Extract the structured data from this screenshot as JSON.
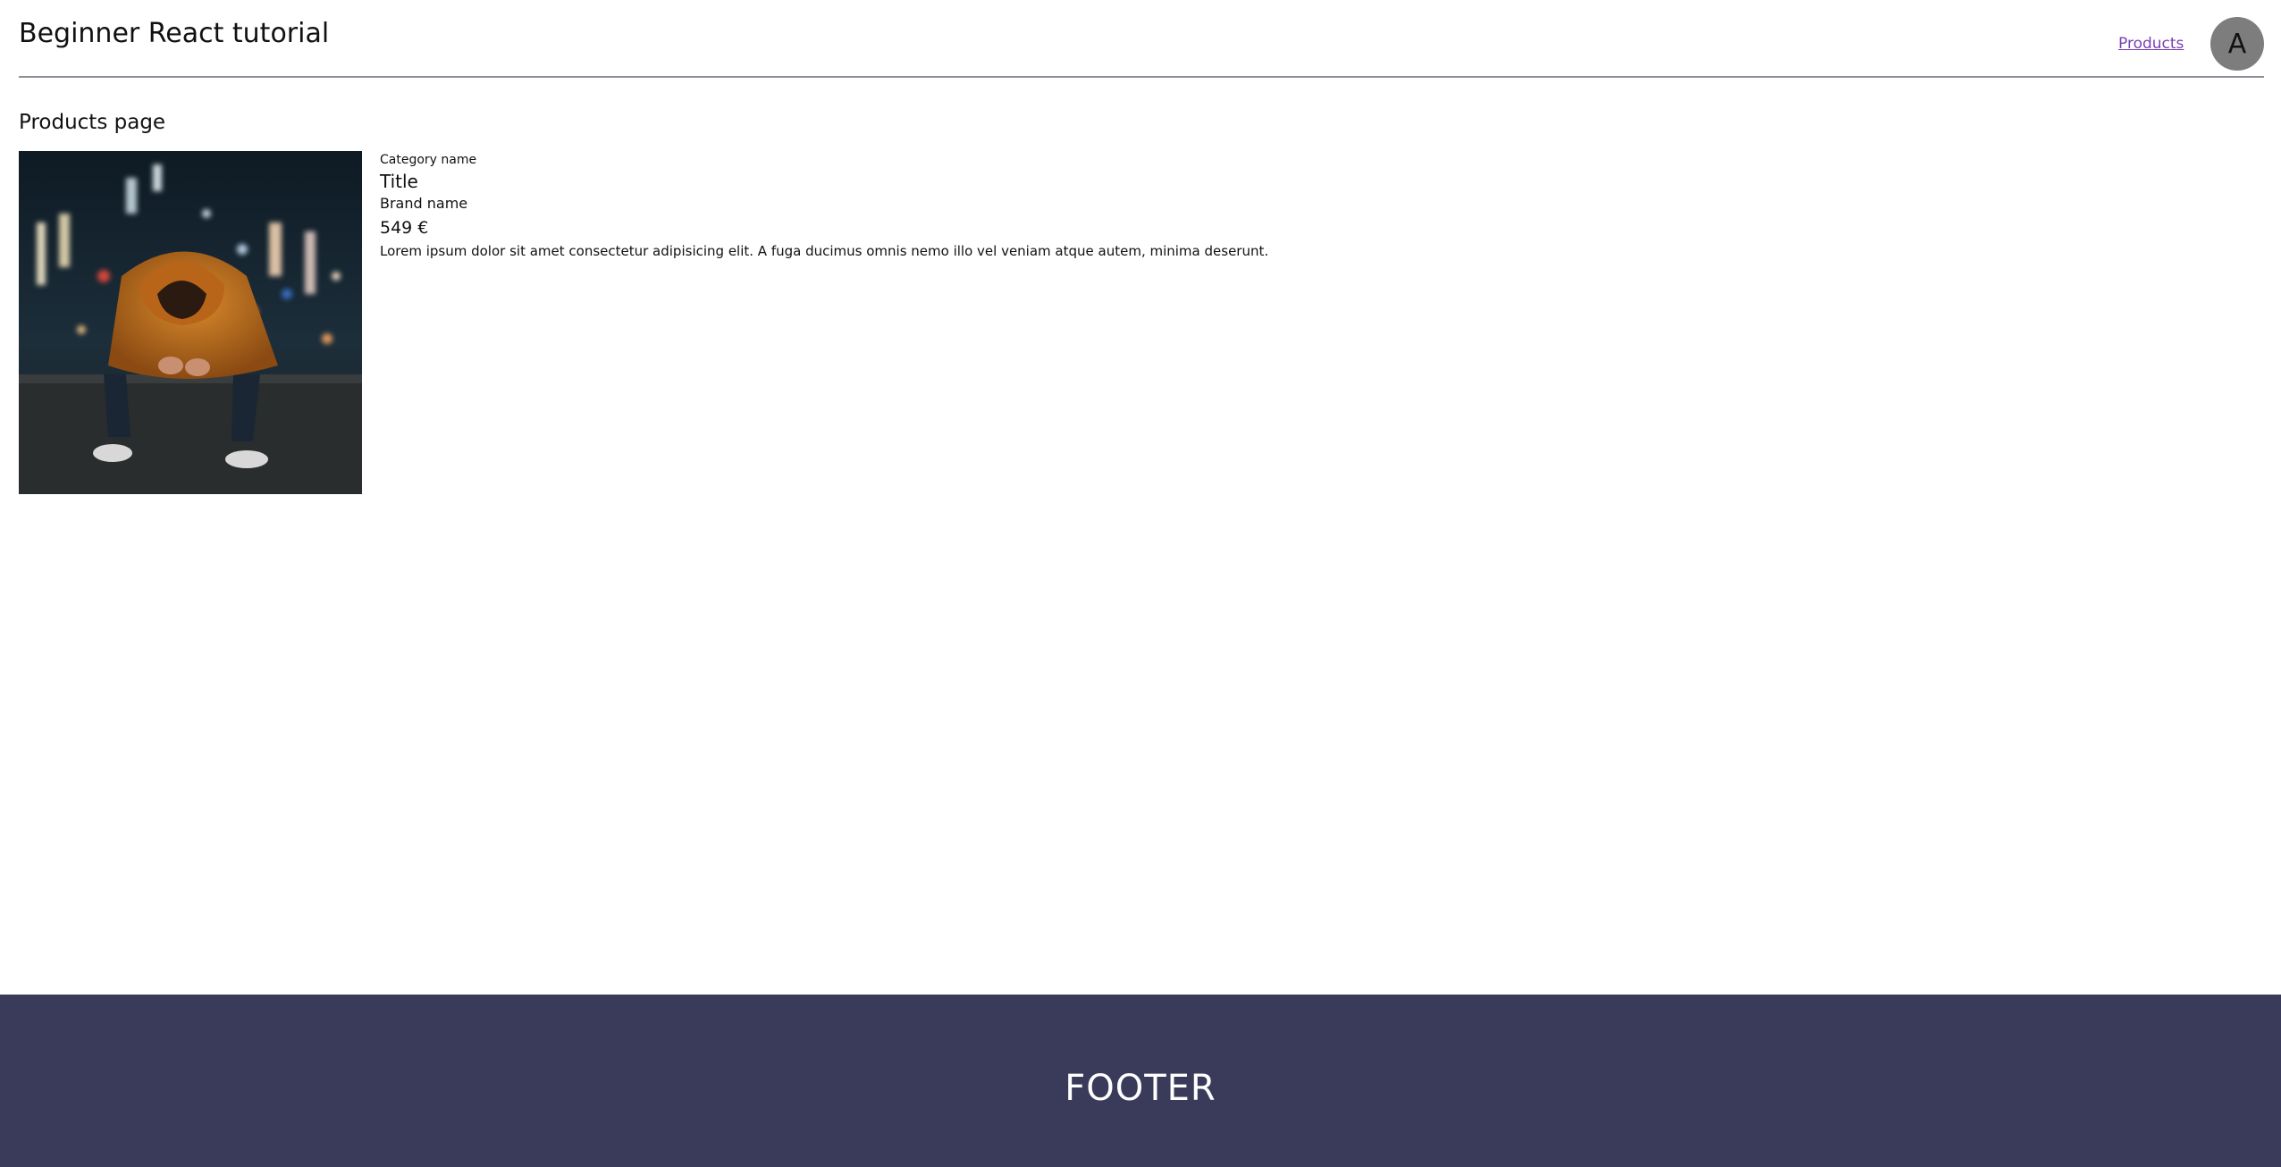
{
  "header": {
    "site_title": "Beginner React tutorial",
    "nav_products_label": "Products",
    "avatar_initial": "A"
  },
  "main": {
    "page_heading": "Products page",
    "product": {
      "image_icon": "hooded-person-photo",
      "category": "Category name",
      "title": "Title",
      "brand": "Brand name",
      "price": "549 €",
      "description": "Lorem ipsum dolor sit amet consectetur adipisicing elit. A fuga ducimus omnis nemo illo vel veniam atque autem, minima deserunt."
    }
  },
  "footer": {
    "text": "FOOTER"
  },
  "colors": {
    "footer_bg": "#3a3a5a",
    "link": "#7b3fb5",
    "avatar_bg": "#7d7d7d",
    "divider": "#8a8f95"
  }
}
